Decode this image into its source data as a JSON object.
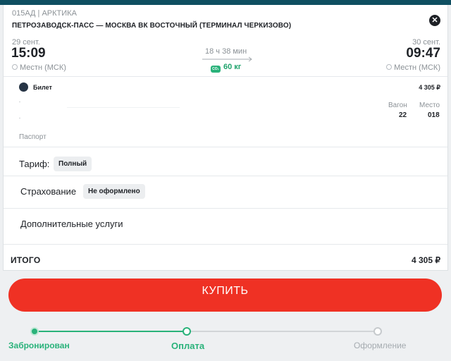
{
  "header": {
    "train_number": "015АД | АРКТИКА",
    "route": "ПЕТРОЗАВОДСК-ПАСС — МОСКВА ВК ВОСТОЧНЫЙ (ТЕРМИНАЛ ЧЕРКИЗОВО)"
  },
  "departure": {
    "date": "29 сент.",
    "time": "15:09",
    "zone": "Местн (МСК)"
  },
  "arrival": {
    "date": "30 сент.",
    "time": "09:47",
    "zone": "Местн (МСК)"
  },
  "trip": {
    "duration": "18 ч 38 мин",
    "co2_badge": "CO₂",
    "co2": "60 кг"
  },
  "ticket": {
    "label": "Билет",
    "price": "4 305 ₽",
    "wagon_label": "Вагон",
    "wagon": "22",
    "seat_label": "Место",
    "seat": "018",
    "passport_label": "Паспорт"
  },
  "tariff": {
    "label": "Тариф:",
    "value": "Полный"
  },
  "insurance": {
    "label": "Страхование",
    "value": "Не оформлено"
  },
  "extra": {
    "label": "Дополнительные услуги"
  },
  "total": {
    "label": "ИТОГО",
    "value": "4 305 ₽"
  },
  "buy_button": {
    "label": "КУПИТЬ"
  },
  "steps": [
    {
      "label": "Забронирован",
      "state": "done"
    },
    {
      "label": "Оплата",
      "state": "current"
    },
    {
      "label": "Оформление",
      "state": "pending"
    }
  ],
  "colors": {
    "accent_green": "#29b27a",
    "buy_red": "#ef3124",
    "top_bar": "#0f4f61",
    "muted_text": "#8b9196"
  }
}
